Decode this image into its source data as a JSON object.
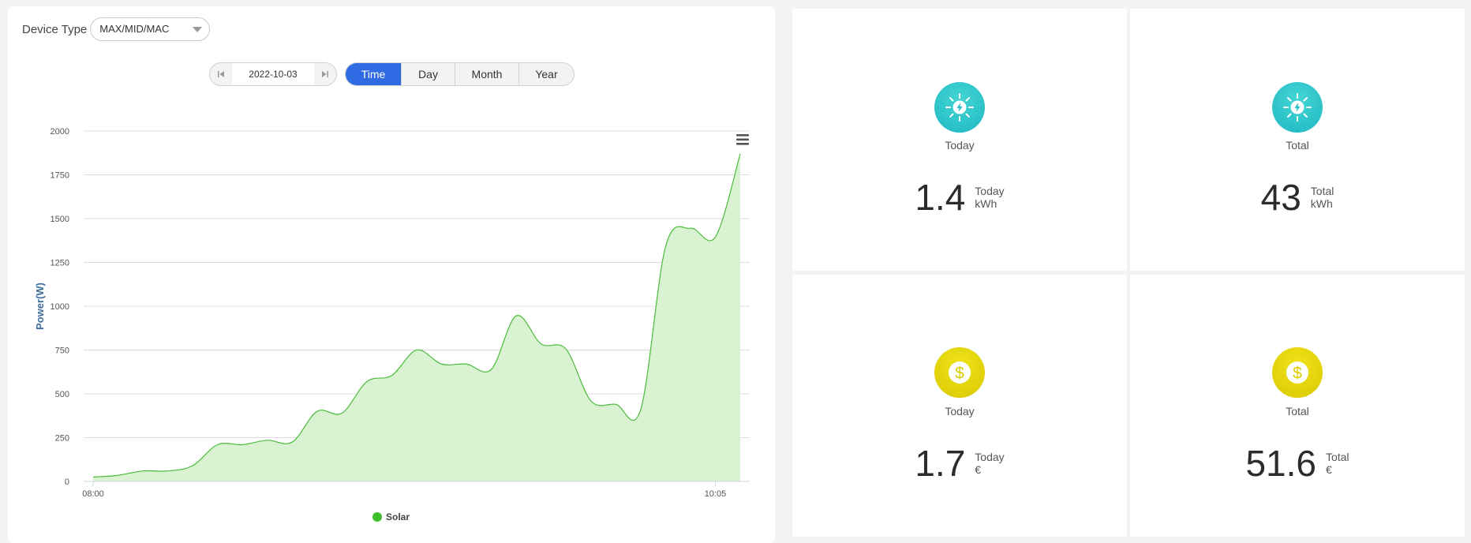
{
  "device": {
    "label": "Device Type",
    "selected": "MAX/MID/MAC"
  },
  "date_nav": {
    "date": "2022-10-03",
    "prev_icon": "first-page-icon",
    "next_icon": "last-page-icon"
  },
  "period_tabs": [
    {
      "label": "Time",
      "active": true
    },
    {
      "label": "Day",
      "active": false
    },
    {
      "label": "Month",
      "active": false
    },
    {
      "label": "Year",
      "active": false
    }
  ],
  "chart_menu_icon": "hamburger-menu-icon",
  "chart_data": {
    "type": "area",
    "ylabel": "Power(W)",
    "xlabel": "",
    "ylim": [
      0,
      2000
    ],
    "yticks": [
      0,
      250,
      500,
      750,
      1000,
      1250,
      1500,
      1750,
      2000
    ],
    "xtick_labels": [
      "08:00",
      "10:05"
    ],
    "legend_position": "bottom",
    "grid": true,
    "series": [
      {
        "name": "Solar",
        "color": "#4cbb3c",
        "fill": "#d8f2d2",
        "x": [
          "08:00",
          "08:05",
          "08:10",
          "08:15",
          "08:20",
          "08:25",
          "08:30",
          "08:35",
          "08:40",
          "08:45",
          "08:50",
          "08:55",
          "09:00",
          "09:05",
          "09:10",
          "09:15",
          "09:20",
          "09:25",
          "09:30",
          "09:35",
          "09:40",
          "09:45",
          "09:50",
          "09:55",
          "10:00",
          "10:05",
          "10:10"
        ],
        "values": [
          25,
          35,
          60,
          60,
          90,
          210,
          210,
          235,
          225,
          400,
          390,
          570,
          605,
          750,
          670,
          670,
          640,
          945,
          785,
          755,
          460,
          440,
          410,
          1340,
          1445,
          1395,
          1870
        ]
      }
    ]
  },
  "stats": [
    {
      "icon": "sun-power-icon",
      "caption": "Today",
      "value": "1.4",
      "unit_line1": "Today",
      "unit_line2": "kWh"
    },
    {
      "icon": "sun-power-icon",
      "caption": "Total",
      "value": "43",
      "unit_line1": "Total",
      "unit_line2": "kWh"
    },
    {
      "icon": "dollar-coin-icon",
      "caption": "Today",
      "value": "1.7",
      "unit_line1": "Today",
      "unit_line2": "€"
    },
    {
      "icon": "dollar-coin-icon",
      "caption": "Total",
      "value": "51.6",
      "unit_line1": "Total",
      "unit_line2": "€"
    }
  ],
  "colors": {
    "accent": "#2f6be3",
    "energy_icon": "#2ec4c9",
    "money_icon": "#e0d200"
  }
}
